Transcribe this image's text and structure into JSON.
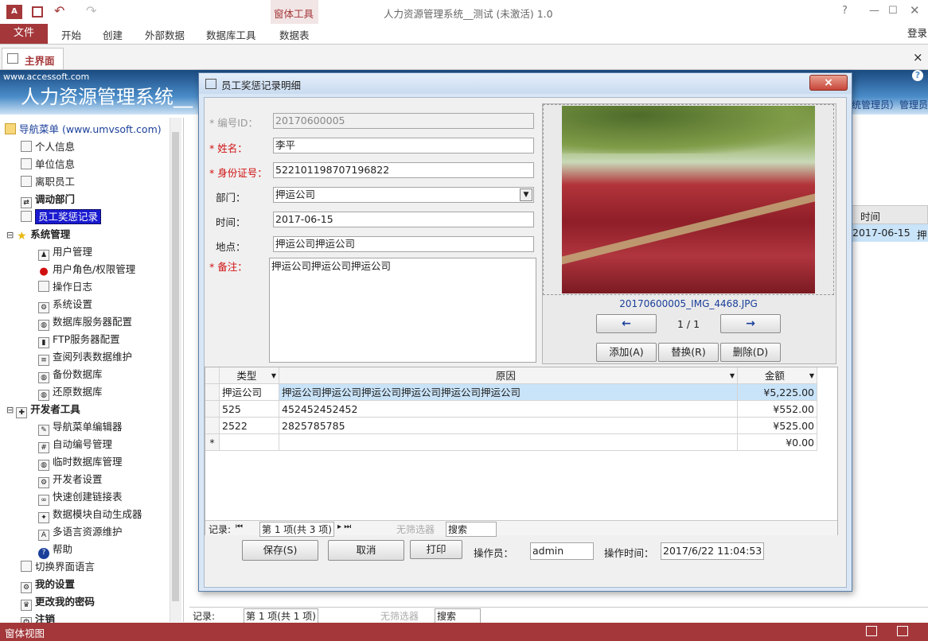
{
  "app": {
    "window_title": "人力资源管理系统__测试 (未激活) 1.0",
    "help": "?",
    "login": "登录",
    "context_group": "窗体工具",
    "ribbon_tabs": [
      "文件",
      "开始",
      "创建",
      "外部数据",
      "数据库工具",
      "数据表"
    ],
    "doc_tab": "主界面",
    "close": "×"
  },
  "banner": {
    "site": "www.accessoft.com",
    "title": "人力资源管理系统__",
    "user_info": "统管理员）管理员"
  },
  "nav": {
    "header": "导航菜单 (www.umvsoft.com)",
    "items": [
      {
        "label": "个人信息",
        "icon": "page-icon",
        "level": 1,
        "bold": false
      },
      {
        "label": "单位信息",
        "icon": "page-icon",
        "level": 1,
        "bold": false
      },
      {
        "label": "离职员工",
        "icon": "page-icon",
        "level": 1,
        "bold": false
      },
      {
        "label": "调动部门",
        "icon": "transfer-icon",
        "level": 1,
        "bold": true
      },
      {
        "label": "员工奖惩记录",
        "icon": "page-icon",
        "level": 1,
        "bold": false,
        "selected": true
      },
      {
        "label": "系统管理",
        "icon": "star-icon",
        "level": 0,
        "bold": true
      },
      {
        "label": "用户管理",
        "icon": "users-icon",
        "level": 2,
        "bold": false
      },
      {
        "label": "用户角色/权限管理",
        "icon": "stop-icon",
        "level": 2,
        "bold": false
      },
      {
        "label": "操作日志",
        "icon": "page-icon",
        "level": 2,
        "bold": false
      },
      {
        "label": "系统设置",
        "icon": "settings-icon",
        "level": 2,
        "bold": false
      },
      {
        "label": "数据库服务器配置",
        "icon": "database-icon",
        "level": 2,
        "bold": false
      },
      {
        "label": "FTP服务器配置",
        "icon": "server-icon",
        "level": 2,
        "bold": false
      },
      {
        "label": "查阅列表数据维护",
        "icon": "list-icon",
        "level": 2,
        "bold": false
      },
      {
        "label": "备份数据库",
        "icon": "database-icon",
        "level": 2,
        "bold": false
      },
      {
        "label": "还原数据库",
        "icon": "database-icon",
        "level": 2,
        "bold": false
      },
      {
        "label": "开发者工具",
        "icon": "tools-icon",
        "level": 0,
        "bold": true
      },
      {
        "label": "导航菜单编辑器",
        "icon": "edit-icon",
        "level": 2,
        "bold": false
      },
      {
        "label": "自动编号管理",
        "icon": "numbering-icon",
        "level": 2,
        "bold": false
      },
      {
        "label": "临时数据库管理",
        "icon": "database-icon",
        "level": 2,
        "bold": false
      },
      {
        "label": "开发者设置",
        "icon": "settings-icon",
        "level": 2,
        "bold": false
      },
      {
        "label": "快速创建链接表",
        "icon": "link-icon",
        "level": 2,
        "bold": false
      },
      {
        "label": "数据模块自动生成器",
        "icon": "generator-icon",
        "level": 2,
        "bold": false
      },
      {
        "label": "多语言资源维护",
        "icon": "language-icon",
        "level": 2,
        "bold": false
      },
      {
        "label": "帮助",
        "icon": "help-icon",
        "level": 2,
        "bold": false
      },
      {
        "label": "切换界面语言",
        "icon": "page-icon",
        "level": 1,
        "bold": false
      },
      {
        "label": "我的设置",
        "icon": "settings-icon",
        "level": 1,
        "bold": true
      },
      {
        "label": "更改我的密码",
        "icon": "user-key-icon",
        "level": 1,
        "bold": true
      },
      {
        "label": "注销",
        "icon": "logout-icon",
        "level": 1,
        "bold": true
      }
    ]
  },
  "background_list": {
    "col_time": "时间",
    "cell_time": "2017-06-15",
    "cell_extra": "押",
    "record_label": "记录:",
    "record_pos": "第 1 项(共 1 项)",
    "no_filter": "无筛选器",
    "search": "搜索"
  },
  "dialog": {
    "title": "员工奖惩记录明细",
    "close": "×",
    "fields": {
      "id_label": "* 编号ID：",
      "id_value": "20170600005",
      "name_label": "* 姓名：",
      "name_value": "李平",
      "idcard_label": "* 身份证号：",
      "idcard_value": "522101198707196822",
      "dept_label": "部门：",
      "dept_value": "押运公司",
      "time_label": "时间：",
      "time_value": "2017-06-15",
      "place_label": "地点：",
      "place_value": "押运公司押运公司",
      "note_label": "* 备注：",
      "note_value": "押运公司押运公司押运公司"
    },
    "image": {
      "filename": "20170600005_IMG_4468.JPG",
      "counter": "1 / 1",
      "prev": "←",
      "next": "→",
      "add": "添加(A)",
      "replace": "替换(R)",
      "delete": "删除(D)"
    },
    "grid": {
      "columns": [
        "类型",
        "原因",
        "金额"
      ],
      "rows": [
        {
          "type": "押运公司",
          "reason": "押运公司押运公司押运公司押运公司押运公司押运公司",
          "amount": "¥5,225.00"
        },
        {
          "type": "525",
          "reason": "452452452452",
          "amount": "¥552.00"
        },
        {
          "type": "2522",
          "reason": "2825785785",
          "amount": "¥525.00"
        },
        {
          "type": "",
          "reason": "",
          "amount": "¥0.00"
        }
      ],
      "new_row_marker": "*",
      "record_label": "记录:",
      "record_pos": "第 1 项(共 3 项)",
      "no_filter": "无筛选器",
      "search": "搜索"
    },
    "footer": {
      "save": "保存(S)",
      "cancel": "取消",
      "print": "打印",
      "operator_label": "操作员：",
      "operator_value": "admin",
      "optime_label": "操作时间：",
      "optime_value": "2017/6/22 11:04:53"
    }
  },
  "statusbar": {
    "text": "窗体视图"
  },
  "colors": {
    "accent": "#a4373a",
    "selection": "#c9e3f8",
    "required": "#d01010"
  }
}
